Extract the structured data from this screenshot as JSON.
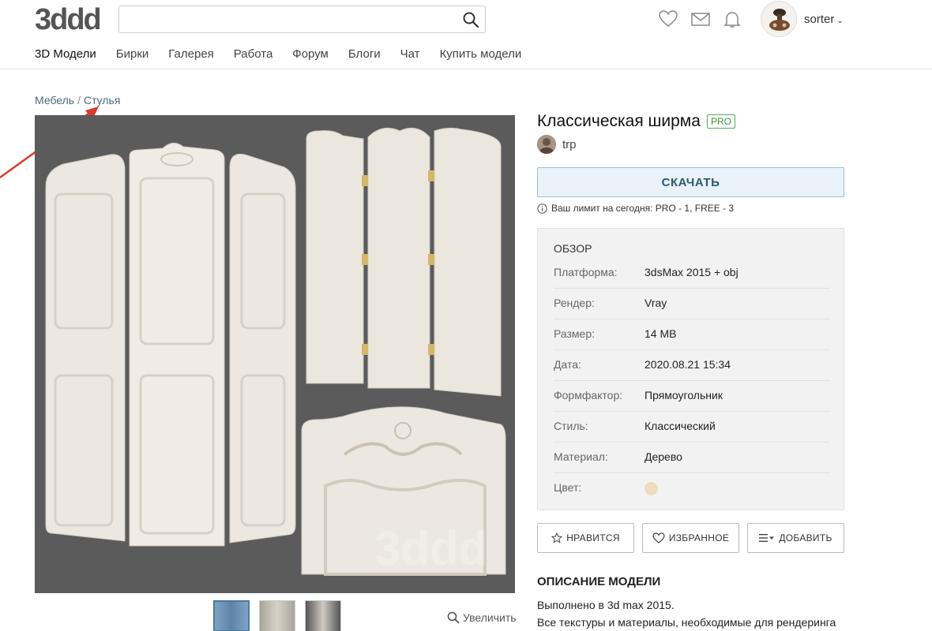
{
  "header": {
    "logo_text": "3ddd",
    "search_placeholder": "",
    "user_name": "sorter",
    "icons": [
      "heart-icon",
      "mail-icon",
      "bell-icon",
      "search-icon"
    ]
  },
  "nav": {
    "items": [
      {
        "label": "3D Модели",
        "active": true
      },
      {
        "label": "Бирки"
      },
      {
        "label": "Галерея"
      },
      {
        "label": "Работа"
      },
      {
        "label": "Форум"
      },
      {
        "label": "Блоги"
      },
      {
        "label": "Чат"
      },
      {
        "label": "Купить модели"
      }
    ]
  },
  "breadcrumb": {
    "level1": "Мебель",
    "separator": "/",
    "level2": "Стулья"
  },
  "product": {
    "title": "Классическая ширма",
    "badge": "PRO",
    "author": "trp",
    "download_label": "СКАЧАТЬ",
    "limit_text": "Ваш лимит на сегодня: PRO - 1, FREE - 3",
    "zoom_label": "Увеличить"
  },
  "overview": {
    "title": "ОБЗОР",
    "rows": [
      {
        "key": "Платформа:",
        "value": "3dsMax 2015 + obj"
      },
      {
        "key": "Рендер:",
        "value": "Vray"
      },
      {
        "key": "Размер:",
        "value": "14 MB"
      },
      {
        "key": "Дата:",
        "value": "2020.08.21 15:34"
      },
      {
        "key": "Формфактор:",
        "value": "Прямоугольник"
      },
      {
        "key": "Стиль:",
        "value": "Классический"
      },
      {
        "key": "Материал:",
        "value": "Дерево"
      },
      {
        "key": "Цвет:",
        "value": ""
      }
    ],
    "color_swatch": "#eedcc0"
  },
  "actions": {
    "like": "НРАВИТСЯ",
    "favorite": "ИЗБРАННОЕ",
    "add": "ДОБАВИТЬ"
  },
  "description": {
    "title": "ОПИСАНИЕ МОДЕЛИ",
    "line1": "Выполнено в 3d max 2015.",
    "line2": "Все текстуры и материалы, необходимые для рендеринга"
  },
  "colors": {
    "accent": "#2c5970",
    "download_bg": "#e8f2f8",
    "pro_green": "#3c8f3c",
    "image_bg": "#5b5b5b",
    "annotation_red": "#d93a2b"
  }
}
